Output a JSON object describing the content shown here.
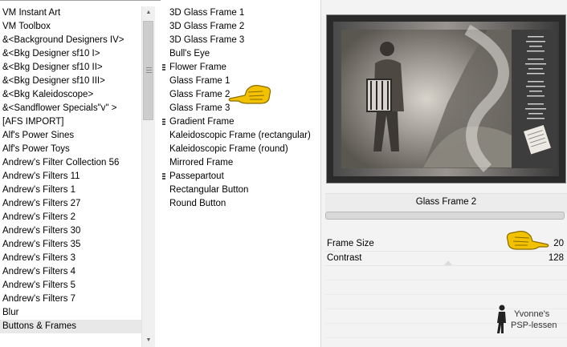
{
  "categories": {
    "items": [
      "VM Instant Art",
      "VM Toolbox",
      "&<Background Designers IV>",
      "&<Bkg Designer sf10 I>",
      "&<Bkg Designer sf10 II>",
      "&<Bkg Designer sf10 III>",
      "&<Bkg Kaleidoscope>",
      "&<Sandflower Specials\"v\" >",
      "[AFS IMPORT]",
      "Alf's Power Sines",
      "Alf's Power Toys",
      "Andrew's Filter Collection 56",
      "Andrew's Filters 11",
      "Andrew's Filters 1",
      "Andrew's Filters 27",
      "Andrew's Filters 2",
      "Andrew's Filters 30",
      "Andrew's Filters 35",
      "Andrew's Filters 3",
      "Andrew's Filters 4",
      "Andrew's Filters 5",
      "Andrew's Filters 7",
      "Blur",
      "Buttons & Frames"
    ],
    "selected": "Buttons & Frames"
  },
  "filters": {
    "items": [
      {
        "label": "3D Glass Frame 1",
        "group": false
      },
      {
        "label": "3D Glass Frame 2",
        "group": false
      },
      {
        "label": "3D Glass Frame 3",
        "group": false
      },
      {
        "label": "Bull's Eye",
        "group": false
      },
      {
        "label": "Flower Frame",
        "group": true
      },
      {
        "label": "Glass Frame 1",
        "group": false
      },
      {
        "label": "Glass Frame 2",
        "group": false
      },
      {
        "label": "Glass Frame 3",
        "group": false
      },
      {
        "label": "Gradient Frame",
        "group": true
      },
      {
        "label": "Kaleidoscopic Frame (rectangular)",
        "group": false
      },
      {
        "label": "Kaleidoscopic Frame (round)",
        "group": false
      },
      {
        "label": "Mirrored Frame",
        "group": false
      },
      {
        "label": "Passepartout",
        "group": true
      },
      {
        "label": "Rectangular Button",
        "group": false
      },
      {
        "label": "Round Button",
        "group": false
      }
    ],
    "selected": "Glass Frame 2"
  },
  "effect": {
    "name": "Glass Frame 2",
    "params": [
      {
        "label": "Frame Size",
        "value": "20"
      },
      {
        "label": "Contrast",
        "value": "128"
      }
    ]
  },
  "watermark": {
    "line1": "Yvonne's",
    "line2": "PSP-lessen"
  },
  "icons": {
    "pointer": "pointing-hand-icon",
    "scroll_up": "scroll-up-arrow-icon",
    "scroll_down": "scroll-down-arrow-icon",
    "group": "group-marker-icon"
  },
  "colors": {
    "pointer": "#f2c200",
    "panel_bg": "#f3f3f3",
    "selected_bg": "#e8e8e8"
  }
}
